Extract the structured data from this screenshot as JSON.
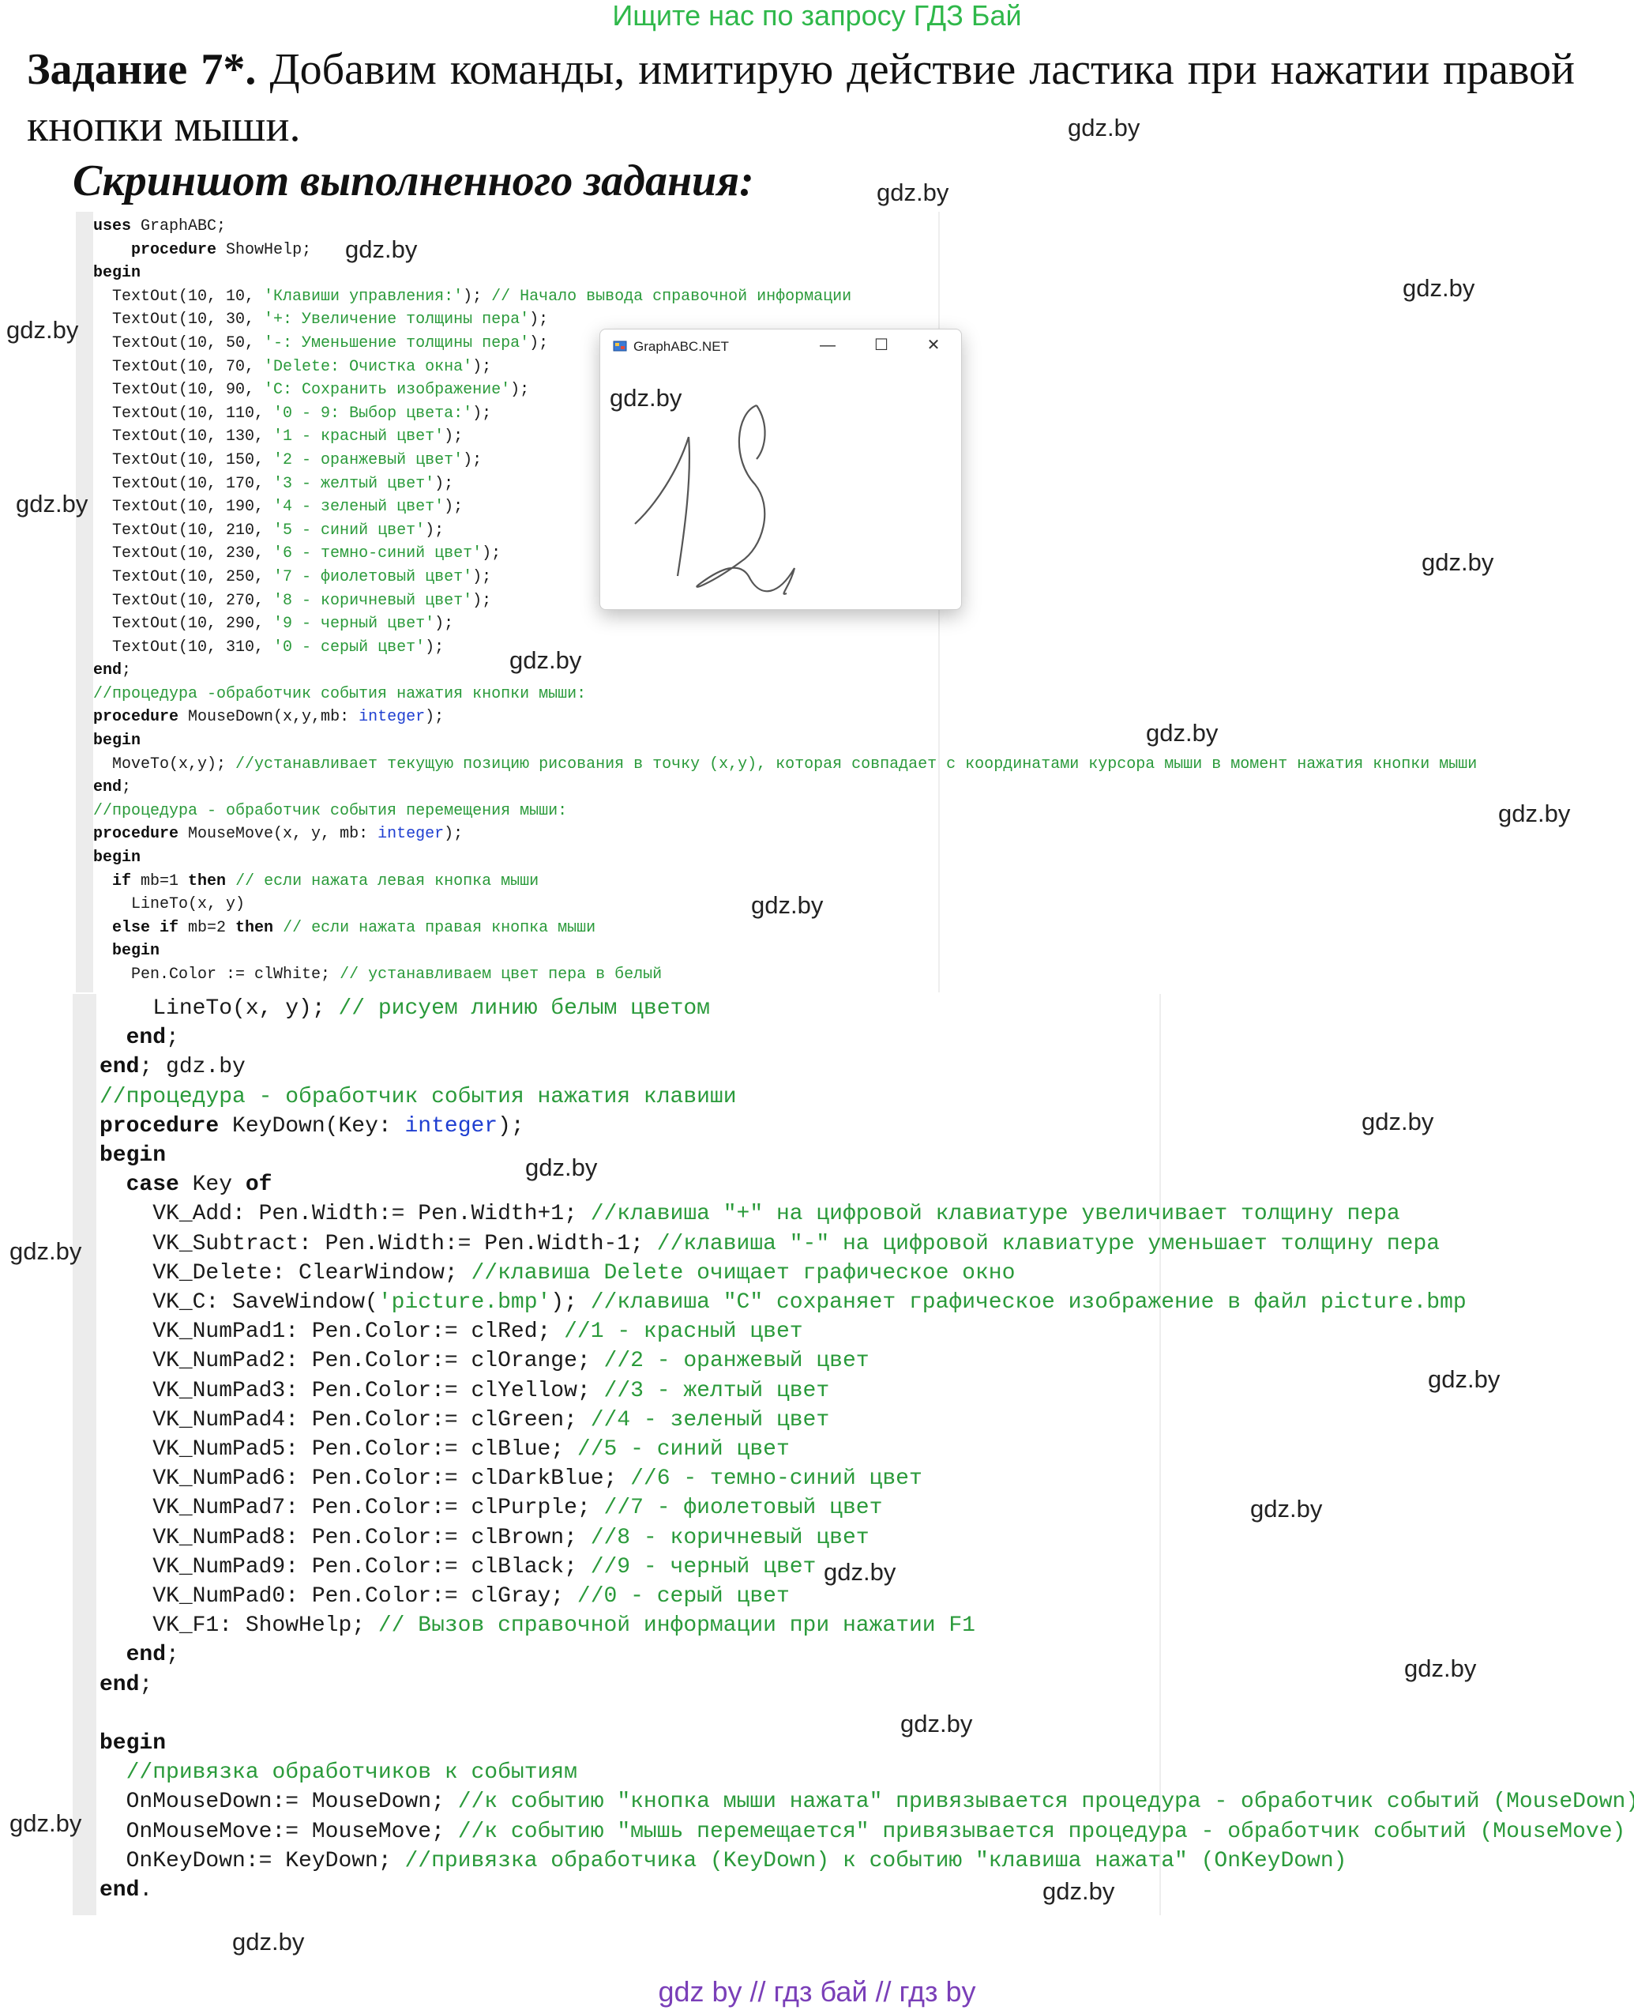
{
  "banner": "Ищите нас по запросу ГДЗ Бай",
  "heading": {
    "label": "Задание 7*.",
    "text": "Добавим команды, имитирую действие ластика при нажатии правой кнопки мыши."
  },
  "subheading": "Скриншот выполненного задания:",
  "watermark": "gdz.by",
  "footer": "gdz by  //  гдз бай  //  гдз by",
  "window": {
    "title": "GraphABC.NET",
    "minimize": "—",
    "maximize": "☐",
    "close": "✕"
  },
  "code_top": [
    [
      [
        "k",
        "uses"
      ],
      [
        "n",
        " GraphABC;"
      ]
    ],
    [
      [
        "n",
        "    "
      ],
      [
        "k",
        "procedure"
      ],
      [
        "n",
        " ShowHelp;"
      ]
    ],
    [
      [
        "k",
        "begin"
      ]
    ],
    [
      [
        "n",
        "  TextOut(10, 10, "
      ],
      [
        "s",
        "'Клавиши управления:'"
      ],
      [
        "n",
        "); "
      ],
      [
        "c",
        "// Начало вывода справочной информации"
      ]
    ],
    [
      [
        "n",
        "  TextOut(10, 30, "
      ],
      [
        "s",
        "'+: Увеличение толщины пера'"
      ],
      [
        "n",
        ");"
      ]
    ],
    [
      [
        "n",
        "  TextOut(10, 50, "
      ],
      [
        "s",
        "'-: Уменьшение толщины пера'"
      ],
      [
        "n",
        ");"
      ]
    ],
    [
      [
        "n",
        "  TextOut(10, 70, "
      ],
      [
        "s",
        "'Delete: Очистка окна'"
      ],
      [
        "n",
        ");"
      ]
    ],
    [
      [
        "n",
        "  TextOut(10, 90, "
      ],
      [
        "s",
        "'C: Сохранить изображение'"
      ],
      [
        "n",
        ");"
      ]
    ],
    [
      [
        "n",
        "  TextOut(10, 110, "
      ],
      [
        "s",
        "'0 - 9: Выбор цвета:'"
      ],
      [
        "n",
        ");"
      ]
    ],
    [
      [
        "n",
        "  TextOut(10, 130, "
      ],
      [
        "s",
        "'1 - красный цвет'"
      ],
      [
        "n",
        ");"
      ]
    ],
    [
      [
        "n",
        "  TextOut(10, 150, "
      ],
      [
        "s",
        "'2 - оранжевый цвет'"
      ],
      [
        "n",
        ");"
      ]
    ],
    [
      [
        "n",
        "  TextOut(10, 170, "
      ],
      [
        "s",
        "'3 - желтый цвет'"
      ],
      [
        "n",
        ");"
      ]
    ],
    [
      [
        "n",
        "  TextOut(10, 190, "
      ],
      [
        "s",
        "'4 - зеленый цвет'"
      ],
      [
        "n",
        ");"
      ]
    ],
    [
      [
        "n",
        "  TextOut(10, 210, "
      ],
      [
        "s",
        "'5 - синий цвет'"
      ],
      [
        "n",
        ");"
      ]
    ],
    [
      [
        "n",
        "  TextOut(10, 230, "
      ],
      [
        "s",
        "'6 - темно-синий цвет'"
      ],
      [
        "n",
        ");"
      ]
    ],
    [
      [
        "n",
        "  TextOut(10, 250, "
      ],
      [
        "s",
        "'7 - фиолетовый цвет'"
      ],
      [
        "n",
        ");"
      ]
    ],
    [
      [
        "n",
        "  TextOut(10, 270, "
      ],
      [
        "s",
        "'8 - коричневый цвет'"
      ],
      [
        "n",
        ");"
      ]
    ],
    [
      [
        "n",
        "  TextOut(10, 290, "
      ],
      [
        "s",
        "'9 - черный цвет'"
      ],
      [
        "n",
        ");"
      ]
    ],
    [
      [
        "n",
        "  TextOut(10, 310, "
      ],
      [
        "s",
        "'0 - серый цвет'"
      ],
      [
        "n",
        ");"
      ]
    ],
    [
      [
        "k",
        "end"
      ],
      [
        "n",
        ";"
      ]
    ],
    [
      [
        "c",
        "//процедура -обработчик события нажатия кнопки мыши:"
      ]
    ],
    [
      [
        "k",
        "procedure"
      ],
      [
        "n",
        " MouseDown(x,y,mb: "
      ],
      [
        "t",
        "integer"
      ],
      [
        "n",
        ");"
      ]
    ],
    [
      [
        "k",
        "begin"
      ]
    ],
    [
      [
        "n",
        "  MoveTo(x,y); "
      ],
      [
        "c",
        "//устанавливает текущую позицию рисования в точку (x,y), которая совпадает с координатами курсора мыши в момент нажатия кнопки мыши"
      ]
    ],
    [
      [
        "k",
        "end"
      ],
      [
        "n",
        ";"
      ]
    ],
    [
      [
        "c",
        "//процедура - обработчик события перемещения мыши:"
      ]
    ],
    [
      [
        "k",
        "procedure"
      ],
      [
        "n",
        " MouseMove(x, y, mb: "
      ],
      [
        "t",
        "integer"
      ],
      [
        "n",
        ");"
      ]
    ],
    [
      [
        "k",
        "begin"
      ]
    ],
    [
      [
        "n",
        "  "
      ],
      [
        "k",
        "if"
      ],
      [
        "n",
        " mb=1 "
      ],
      [
        "k",
        "then"
      ],
      [
        "n",
        " "
      ],
      [
        "c",
        "// если нажата левая кнопка мыши"
      ]
    ],
    [
      [
        "n",
        "    LineTo(x, y)"
      ]
    ],
    [
      [
        "n",
        "  "
      ],
      [
        "k",
        "else if"
      ],
      [
        "n",
        " mb=2 "
      ],
      [
        "k",
        "then"
      ],
      [
        "n",
        " "
      ],
      [
        "c",
        "// если нажата правая кнопка мыши"
      ]
    ],
    [
      [
        "n",
        "  "
      ],
      [
        "k",
        "begin"
      ]
    ],
    [
      [
        "n",
        "    Pen.Color := clWhite; "
      ],
      [
        "c",
        "// устанавливаем цвет пера в белый"
      ]
    ]
  ],
  "code_bottom": [
    [
      [
        "n",
        "    LineTo(x, y); "
      ],
      [
        "c",
        "// рисуем линию белым цветом"
      ]
    ],
    [
      [
        "n",
        "  "
      ],
      [
        "k",
        "end"
      ],
      [
        "n",
        ";"
      ]
    ],
    [
      [
        "k",
        "end"
      ],
      [
        "n",
        "; gdz.by"
      ]
    ],
    [
      [
        "c",
        "//процедура - обработчик события нажатия клавиши"
      ]
    ],
    [
      [
        "k",
        "procedure"
      ],
      [
        "n",
        " KeyDown(Key: "
      ],
      [
        "t",
        "integer"
      ],
      [
        "n",
        ");"
      ]
    ],
    [
      [
        "k",
        "begin"
      ]
    ],
    [
      [
        "n",
        "  "
      ],
      [
        "k",
        "case"
      ],
      [
        "n",
        " Key "
      ],
      [
        "k",
        "of"
      ]
    ],
    [
      [
        "n",
        "    VK_Add: Pen.Width:= Pen.Width+1; "
      ],
      [
        "c",
        "//клавиша \"+\" на цифровой клавиатуре увеличивает толщину пера"
      ]
    ],
    [
      [
        "n",
        "    VK_Subtract: Pen.Width:= Pen.Width-1; "
      ],
      [
        "c",
        "//клавиша \"-\" на цифровой клавиатуре уменьшает толщину пера"
      ]
    ],
    [
      [
        "n",
        "    VK_Delete: ClearWindow; "
      ],
      [
        "c",
        "//клавиша Delete очищает графическое окно"
      ]
    ],
    [
      [
        "n",
        "    VK_C: SaveWindow("
      ],
      [
        "s",
        "'picture.bmp'"
      ],
      [
        "n",
        "); "
      ],
      [
        "c",
        "//клавиша \"C\" сохраняет графическое изображение в файл picture.bmp"
      ]
    ],
    [
      [
        "n",
        "    VK_NumPad1: Pen.Color:= clRed; "
      ],
      [
        "c",
        "//1 - красный цвет"
      ]
    ],
    [
      [
        "n",
        "    VK_NumPad2: Pen.Color:= clOrange; "
      ],
      [
        "c",
        "//2 - оранжевый цвет"
      ]
    ],
    [
      [
        "n",
        "    VK_NumPad3: Pen.Color:= clYellow; "
      ],
      [
        "c",
        "//3 - желтый цвет"
      ]
    ],
    [
      [
        "n",
        "    VK_NumPad4: Pen.Color:= clGreen; "
      ],
      [
        "c",
        "//4 - зеленый цвет"
      ]
    ],
    [
      [
        "n",
        "    VK_NumPad5: Pen.Color:= clBlue; "
      ],
      [
        "c",
        "//5 - синий цвет"
      ]
    ],
    [
      [
        "n",
        "    VK_NumPad6: Pen.Color:= clDarkBlue; "
      ],
      [
        "c",
        "//6 - темно-синий цвет"
      ]
    ],
    [
      [
        "n",
        "    VK_NumPad7: Pen.Color:= clPurple; "
      ],
      [
        "c",
        "//7 - фиолетовый цвет"
      ]
    ],
    [
      [
        "n",
        "    VK_NumPad8: Pen.Color:= clBrown; "
      ],
      [
        "c",
        "//8 - коричневый цвет"
      ]
    ],
    [
      [
        "n",
        "    VK_NumPad9: Pen.Color:= clBlack; "
      ],
      [
        "c",
        "//9 - черный цвет"
      ]
    ],
    [
      [
        "n",
        "    VK_NumPad0: Pen.Color:= clGray; "
      ],
      [
        "c",
        "//0 - серый цвет"
      ]
    ],
    [
      [
        "n",
        "    VK_F1: ShowHelp; "
      ],
      [
        "c",
        "// Вызов справочной информации при нажатии F1"
      ]
    ],
    [
      [
        "n",
        "  "
      ],
      [
        "k",
        "end"
      ],
      [
        "n",
        ";"
      ]
    ],
    [
      [
        "k",
        "end"
      ],
      [
        "n",
        ";"
      ]
    ],
    [
      [
        "n",
        ""
      ]
    ],
    [
      [
        "k",
        "begin"
      ]
    ],
    [
      [
        "n",
        "  "
      ],
      [
        "c",
        "//привязка обработчиков к событиям"
      ]
    ],
    [
      [
        "n",
        "  OnMouseDown:= MouseDown; "
      ],
      [
        "c",
        "//к событию \"кнопка мыши нажата\" привязывается процедура - обработчик событий (MouseDown)"
      ]
    ],
    [
      [
        "n",
        "  OnMouseMove:= MouseMove; "
      ],
      [
        "c",
        "//к событию \"мышь перемещается\" привязывается процедура - обработчик событий (MouseMove)"
      ]
    ],
    [
      [
        "n",
        "  OnKeyDown:= KeyDown; "
      ],
      [
        "c",
        "//привязка обработчика (KeyDown) к событию \"клавиша нажата\" (OnKeyDown)"
      ]
    ],
    [
      [
        "k",
        "end"
      ],
      [
        "n",
        "."
      ]
    ]
  ],
  "colors": {
    "comment": "#2a9a3a",
    "type": "#1f3fd1",
    "banner": "#2fb84a",
    "footer": "#7a3fb8"
  }
}
